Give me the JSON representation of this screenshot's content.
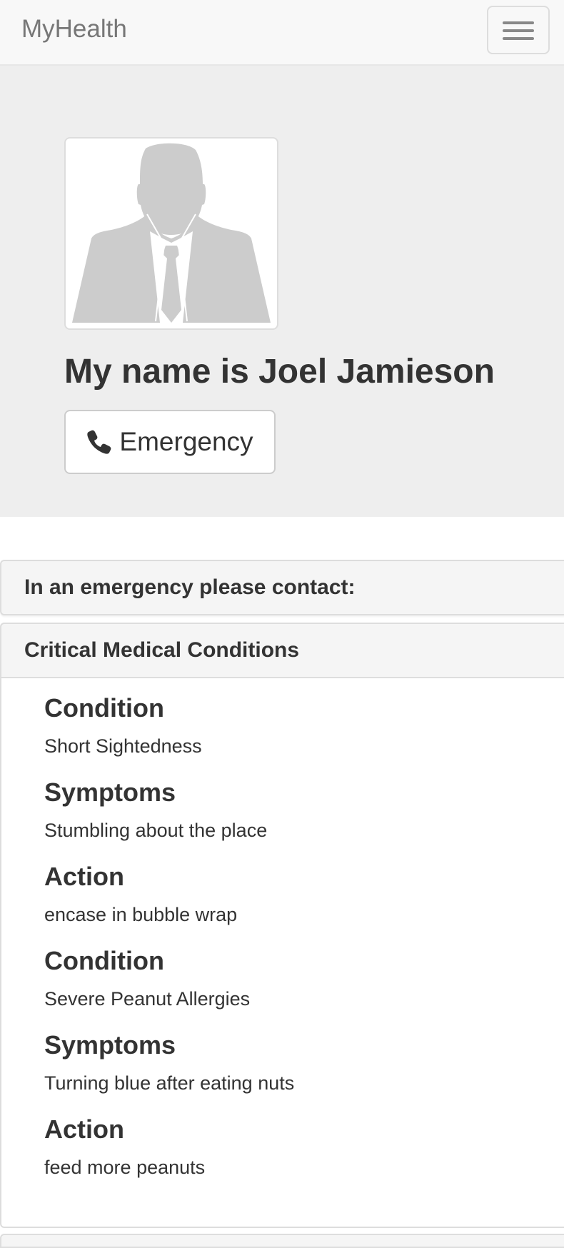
{
  "navbar": {
    "brand": "MyHealth"
  },
  "profile": {
    "heading": "My name is Joel Jamieson",
    "emergency_label": "Emergency"
  },
  "contact_panel": {
    "title": "In an emergency please contact:"
  },
  "conditions_panel": {
    "title": "Critical Medical Conditions",
    "entries": [
      {
        "label": "Condition",
        "value": "Short Sightedness"
      },
      {
        "label": "Symptoms",
        "value": "Stumbling about the place"
      },
      {
        "label": "Action",
        "value": "encase in bubble wrap"
      },
      {
        "label": "Condition",
        "value": "Severe Peanut Allergies"
      },
      {
        "label": "Symptoms",
        "value": "Turning blue after eating nuts"
      },
      {
        "label": "Action",
        "value": "feed more peanuts"
      }
    ]
  },
  "colors": {
    "navbar_bg": "#f8f8f8",
    "jumbotron_bg": "#eeeeee",
    "panel_heading_bg": "#f5f5f5",
    "text": "#333333",
    "brand_text": "#777777"
  },
  "icons": {
    "menu": "hamburger-icon",
    "avatar": "person-silhouette-icon",
    "emergency": "phone-icon"
  }
}
